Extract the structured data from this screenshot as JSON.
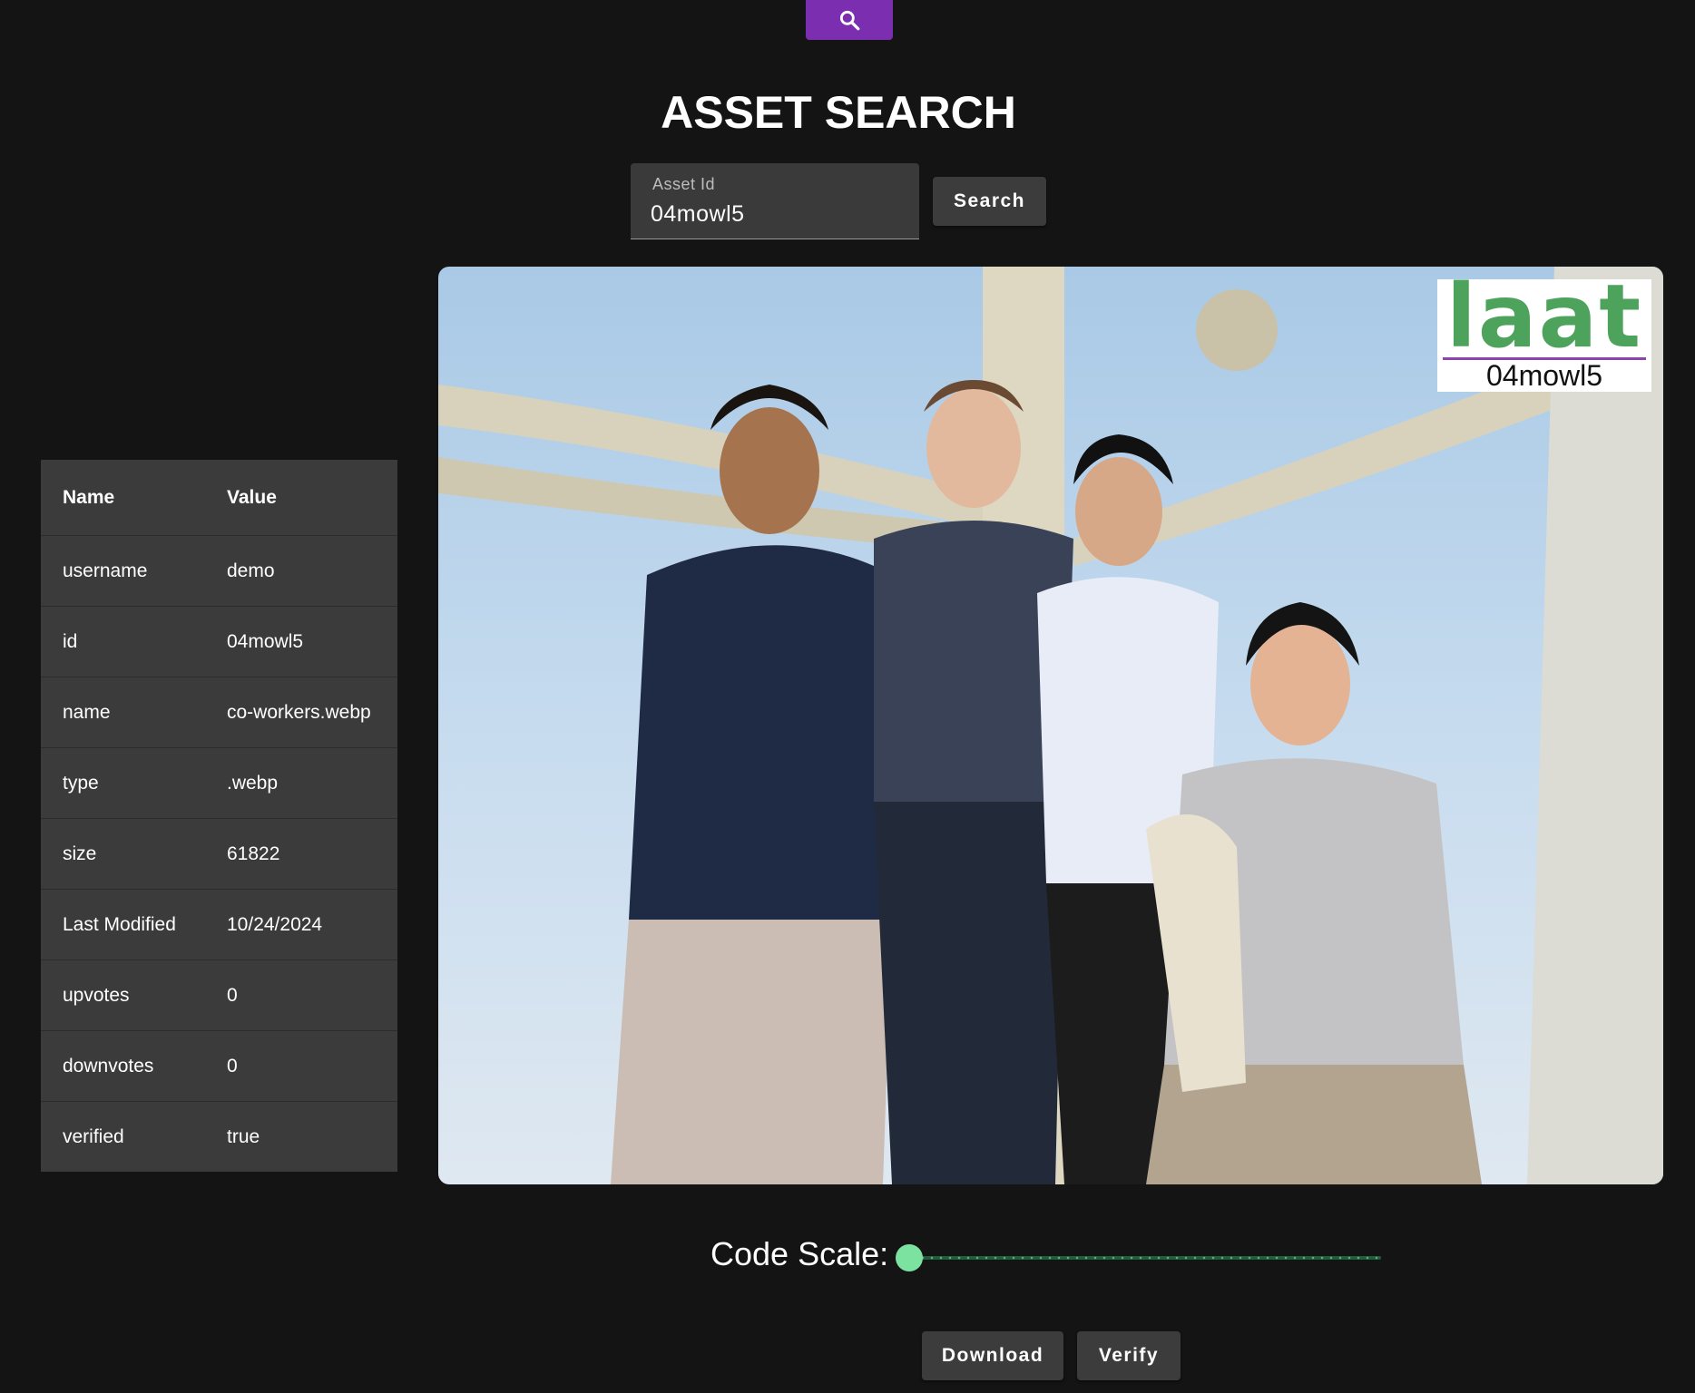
{
  "header": {
    "title": "ASSET SEARCH"
  },
  "search": {
    "label": "Asset Id",
    "value": "04mowl5",
    "button_label": "Search"
  },
  "metadata": {
    "headers": [
      "Name",
      "Value"
    ],
    "rows": [
      [
        "username",
        "demo"
      ],
      [
        "id",
        "04mowl5"
      ],
      [
        "name",
        "co-workers.webp"
      ],
      [
        "type",
        ".webp"
      ],
      [
        "size",
        "61822"
      ],
      [
        "Last Modified",
        "10/24/2024"
      ],
      [
        "upvotes",
        "0"
      ],
      [
        "downvotes",
        "0"
      ],
      [
        "verified",
        "true"
      ]
    ]
  },
  "image": {
    "watermark_logo": "laat",
    "watermark_code": "04mowl5"
  },
  "controls": {
    "code_scale_label": "Code Scale:",
    "code_scale_level": 0,
    "download_label": "Download",
    "verify_label": "Verify"
  },
  "colors": {
    "accent": "#7b2fb0",
    "background": "#141414",
    "panel": "#3b3b3b",
    "slider_thumb": "#7be2a0",
    "watermark_green": "#4da35b",
    "watermark_rule": "#8e44ad"
  }
}
